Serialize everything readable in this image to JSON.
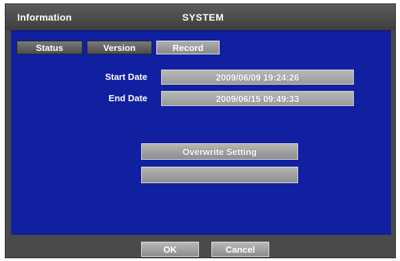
{
  "header": {
    "left_title": "Information",
    "center_title": "SYSTEM"
  },
  "tabs": [
    {
      "label": "Status",
      "active": false
    },
    {
      "label": "Version",
      "active": false
    },
    {
      "label": "Record",
      "active": true
    }
  ],
  "record": {
    "start_date_label": "Start Date",
    "start_date_value": "2009/06/09 19:24:26",
    "end_date_label": "End Date",
    "end_date_value": "2009/06/15 09:49:33",
    "overwrite_button": "Overwrite Setting",
    "disabled_button": ""
  },
  "footer": {
    "ok_label": "OK",
    "cancel_label": "Cancel"
  },
  "colors": {
    "panel_blue": "#1020a0",
    "frame_gray": "#4a4a4a",
    "button_gray": "#a5a5a5"
  }
}
